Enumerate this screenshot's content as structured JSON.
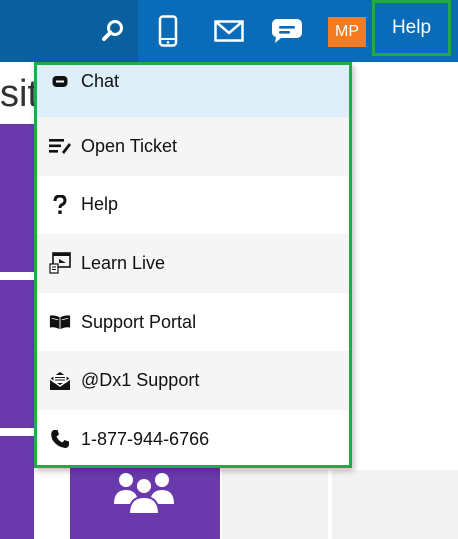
{
  "topbar": {
    "icons": [
      "search-icon",
      "phone-icon",
      "mail-icon",
      "chat-bubble-icon"
    ],
    "avatar_initials": "MP",
    "help_label": "Help",
    "colors": {
      "bar": "#0a6cb8",
      "bar_left": "#0a5f9f",
      "avatar": "#f47b20",
      "highlight": "#22a94a"
    }
  },
  "background": {
    "title_fragment": "sit",
    "tile_color": "#6a3aad"
  },
  "help_menu": {
    "items": [
      {
        "label": "Chat",
        "icon": "chat-icon"
      },
      {
        "label": "Open Ticket",
        "icon": "ticket-icon"
      },
      {
        "label": "Help",
        "icon": "question-icon"
      },
      {
        "label": "Learn Live",
        "icon": "learn-live-icon"
      },
      {
        "label": "Support Portal",
        "icon": "book-icon"
      },
      {
        "label": "@Dx1 Support",
        "icon": "envelope-icon"
      },
      {
        "label": "1-877-944-6766",
        "icon": "phone-handset-icon"
      }
    ]
  }
}
